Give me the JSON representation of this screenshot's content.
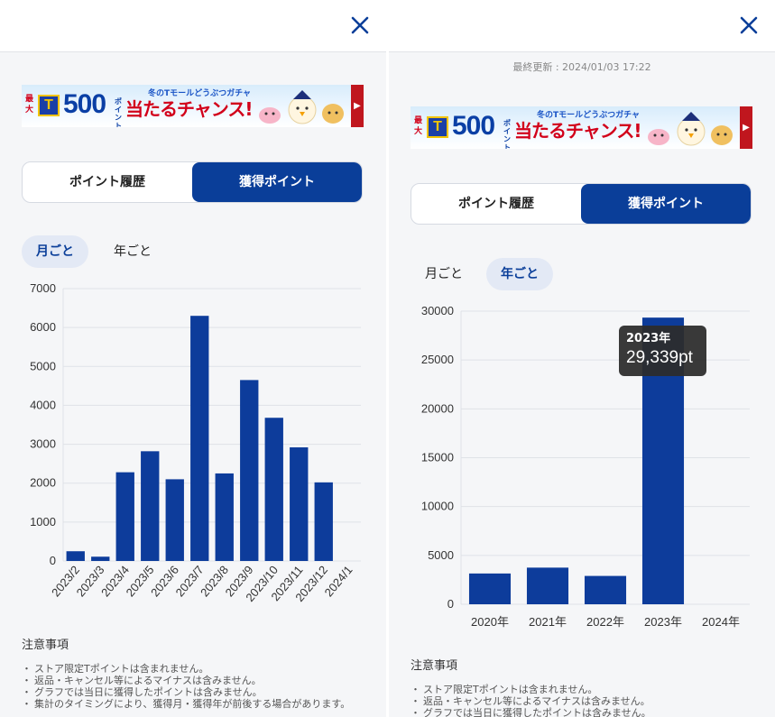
{
  "left": {
    "close_icon": "close-icon",
    "banner": {
      "saidai": "最大",
      "t_logo": "T",
      "amount": "500",
      "amount_unit": "ポイント",
      "tagline": "冬のTモールどうぶつガチャ",
      "catch": "当たるチャンス!",
      "arrow": "▶"
    },
    "segment": {
      "history_label": "ポイント履歴",
      "earned_label": "獲得ポイント",
      "active": "earned"
    },
    "tabs": {
      "monthly": "月ごと",
      "yearly": "年ごと",
      "active": "monthly"
    },
    "notes": {
      "title": "注意事項",
      "items": [
        "ストア限定Tポイントは含まれません。",
        "返品・キャンセル等によるマイナスは含みません。",
        "グラフでは当日に獲得したポイントは含みません。",
        "集計のタイミングにより、獲得月・獲得年が前後する場合があります。"
      ]
    }
  },
  "right": {
    "close_icon": "close-icon",
    "last_updated": "最終更新 : 2024/01/03 17:22",
    "banner": {
      "saidai": "最大",
      "t_logo": "T",
      "amount": "500",
      "amount_unit": "ポイント",
      "tagline": "冬のTモールどうぶつガチャ",
      "catch": "当たるチャンス!",
      "arrow": "▶"
    },
    "segment": {
      "history_label": "ポイント履歴",
      "earned_label": "獲得ポイント",
      "active": "earned"
    },
    "tabs": {
      "monthly": "月ごと",
      "yearly": "年ごと",
      "active": "yearly"
    },
    "tooltip": {
      "year": "2023年",
      "value": "29,339pt"
    },
    "notes": {
      "title": "注意事項",
      "items": [
        "ストア限定Tポイントは含まれません。",
        "返品・キャンセル等によるマイナスは含みません。",
        "グラフでは当日に獲得したポイントは含みません。"
      ]
    }
  },
  "colors": {
    "accent": "#0a3e99",
    "bar": "#0d3c9b",
    "tooltip_bg": "#2d2d2d"
  },
  "chart_data": [
    {
      "type": "bar",
      "categories": [
        "2023/2",
        "2023/3",
        "2023/4",
        "2023/5",
        "2023/6",
        "2023/7",
        "2023/8",
        "2023/9",
        "2023/10",
        "2023/11",
        "2023/12",
        "2024/1"
      ],
      "values": [
        250,
        110,
        2280,
        2820,
        2100,
        6300,
        2250,
        4650,
        3680,
        2920,
        2020,
        0
      ],
      "ylim": [
        0,
        7000
      ],
      "yticks": [
        0,
        1000,
        2000,
        3000,
        4000,
        5000,
        6000,
        7000
      ],
      "grid": true
    },
    {
      "type": "bar",
      "categories": [
        "2020年",
        "2021年",
        "2022年",
        "2023年",
        "2024年"
      ],
      "values": [
        3150,
        3750,
        2900,
        29339,
        0
      ],
      "ylim": [
        0,
        30000
      ],
      "yticks": [
        0,
        5000,
        10000,
        15000,
        20000,
        25000,
        30000
      ],
      "grid": true
    }
  ]
}
